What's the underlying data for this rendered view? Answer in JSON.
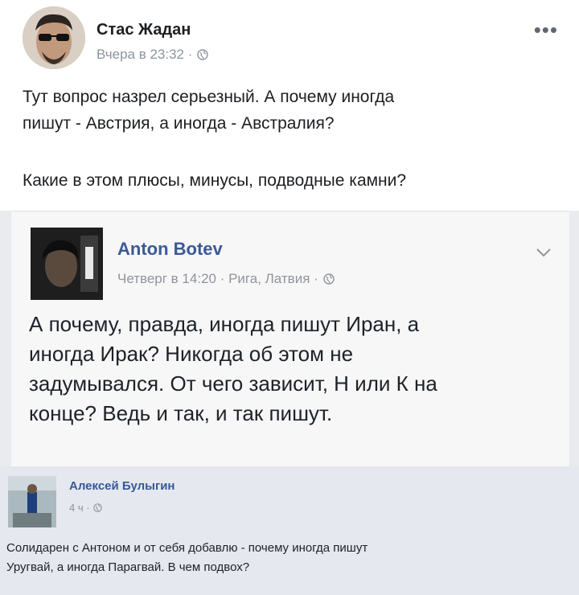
{
  "post": {
    "author": "Стас Жадан",
    "timestamp": "Вчера в 23:32 ·",
    "privacy_icon": "globe-icon",
    "more_label": "•••",
    "text_line1": "Тут вопрос назрел серьезный. А почему иногда",
    "text_line2": "пишут - Австрия, а иногда - Австралия?",
    "text_line3": "Какие в этом плюсы, минусы, подводные камни?"
  },
  "shared_post": {
    "author": "Anton Botev",
    "timestamp": "Четверг в 14:20 · Рига, Латвия ·",
    "privacy_icon": "globe-icon",
    "menu_icon": "chevron-down-icon",
    "text_line1": "А почему, правда, иногда пишут Иран, а",
    "text_line2": "иногда Ирак? Никогда об этом не",
    "text_line3": "задумывался. От чего зависит, Н или К на",
    "text_line4": "конце? Ведь и так, и так пишут."
  },
  "comment": {
    "author": "Алексей Булыгин",
    "timestamp": "4 ч ·",
    "privacy_icon": "globe-icon",
    "text_line1": "Солидарен с Антоном и от себя добавлю - почему иногда пишут",
    "text_line2": "Уругвай, а иногда Парагвай. В чем подвох?"
  },
  "colors": {
    "link_blue": "#3b5998",
    "meta_gray": "#90949c",
    "background": "#ffffff"
  }
}
